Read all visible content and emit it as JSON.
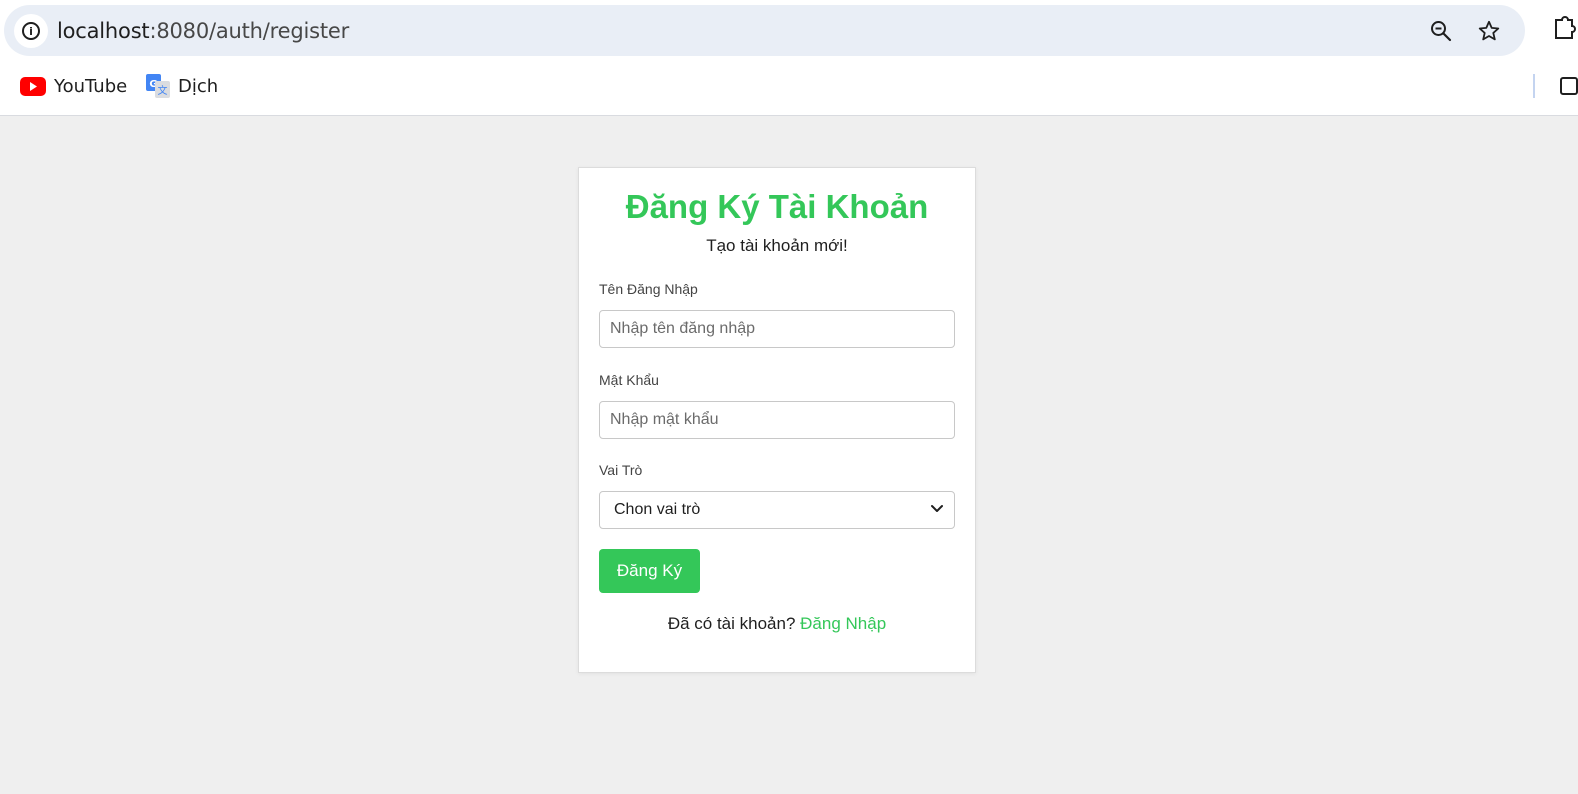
{
  "browser": {
    "url_host": "localhost",
    "url_path": ":8080/auth/register",
    "bookmarks": [
      {
        "label": "YouTube",
        "icon": "youtube-icon"
      },
      {
        "label": "Dịch",
        "icon": "google-translate-icon"
      }
    ],
    "icons": {
      "site_info": "info-icon",
      "zoom": "zoom-out-icon",
      "star": "bookmark-star-icon",
      "extensions": "extensions-icon"
    }
  },
  "form": {
    "title": "Đăng Ký Tài Khoản",
    "subtitle": "Tạo tài khoản mới!",
    "username": {
      "label": "Tên Đăng Nhập",
      "placeholder": "Nhập tên đăng nhập",
      "value": ""
    },
    "password": {
      "label": "Mật Khẩu",
      "placeholder": "Nhập mật khẩu",
      "value": ""
    },
    "role": {
      "label": "Vai Trò",
      "selected": "Chon vai trò"
    },
    "submit_label": "Đăng Ký",
    "login_prompt": "Đã có tài khoản?",
    "login_link": "Đăng Nhập"
  },
  "colors": {
    "accent": "#34c759",
    "page_bg": "#efefef",
    "omnibox_bg": "#e9eef6"
  }
}
